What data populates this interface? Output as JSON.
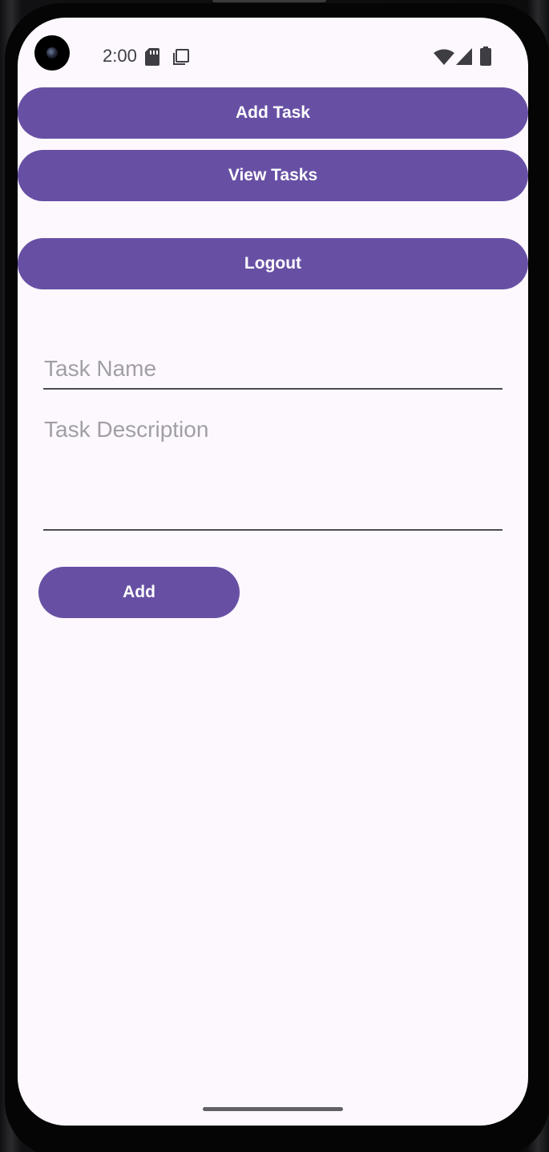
{
  "status_bar": {
    "time": "2:00",
    "icons": [
      "sd-card-icon",
      "screenshot-icon",
      "wifi-icon",
      "cell-signal-icon",
      "battery-icon"
    ]
  },
  "nav_buttons": {
    "add_task": "Add Task",
    "view_tasks": "View Tasks",
    "logout": "Logout"
  },
  "form": {
    "task_name": {
      "placeholder": "Task Name",
      "value": ""
    },
    "task_description": {
      "placeholder": "Task Description",
      "value": ""
    },
    "submit_label": "Add"
  },
  "colors": {
    "primary": "#6750a4",
    "background": "#fdf8fd",
    "placeholder": "#a19ea6",
    "underline": "#4e4a54"
  }
}
